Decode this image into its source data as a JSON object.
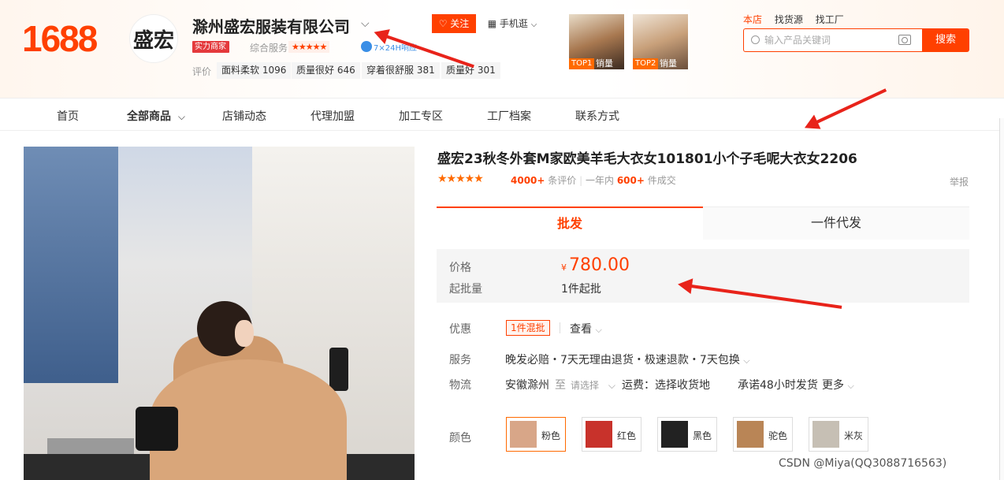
{
  "header": {
    "logo": "1688",
    "shop_avatar_text": "盛宏",
    "shop_name": "滁州盛宏服装有限公司",
    "badge_power": "实力商家",
    "service_label": "综合服务",
    "service_stars": "★★★★★",
    "support_text": "7×24H响应",
    "review_label": "评价",
    "tags": [
      {
        "label": "面料柔软",
        "count": "1096"
      },
      {
        "label": "质量很好",
        "count": "646"
      },
      {
        "label": "穿着很舒服",
        "count": "381"
      },
      {
        "label": "质量好",
        "count": "301"
      }
    ],
    "follow_label": "关注",
    "mobile_label": "手机逛",
    "top_items": [
      {
        "rank": "TOP1",
        "label": "销量"
      },
      {
        "rank": "TOP2",
        "label": "销量"
      }
    ],
    "search_tabs": [
      "本店",
      "找货源",
      "找工厂"
    ],
    "search_placeholder": "输入产品关键词",
    "search_button": "搜索"
  },
  "nav": [
    "首页",
    "全部商品",
    "店铺动态",
    "代理加盟",
    "加工专区",
    "工厂档案",
    "联系方式"
  ],
  "product": {
    "title": "盛宏23秋冬外套M家欧美羊毛大衣女101801小个子毛呢大衣女2206",
    "stars": "★★★★★",
    "review_count": "4000+",
    "review_suffix": "条评价",
    "year_label": "一年内",
    "sold_count": "600+",
    "sold_suffix": "件成交",
    "report": "举报",
    "tabs": [
      "批发",
      "一件代发"
    ],
    "price_label": "价格",
    "currency": "¥",
    "price": "780.00",
    "moq_label": "起批量",
    "moq": "1件起批",
    "promo_label": "优惠",
    "promo_tag": "1件混批",
    "promo_view": "查看",
    "service_label": "服务",
    "service_text": "晚发必赔・7天无理由退货・极速退款・7天包换",
    "logistics_label": "物流",
    "from_city": "安徽滁州",
    "to_label": "至",
    "to_select": "请选择",
    "freight": "运费：选择收货地",
    "ship_promise": "承诺48小时发货",
    "more": "更多",
    "color_label": "颜色",
    "colors": [
      {
        "name": "粉色",
        "swatch": "#d8a688"
      },
      {
        "name": "红色",
        "swatch": "#c8322b"
      },
      {
        "name": "黑色",
        "swatch": "#222222"
      },
      {
        "name": "驼色",
        "swatch": "#b98556"
      },
      {
        "name": "米灰",
        "swatch": "#c6bfb4"
      }
    ]
  },
  "watermark": "CSDN @Miya(QQ3088716563)",
  "colors": {
    "accent": "#ff4000",
    "annotation_arrow": "#e8231a"
  }
}
